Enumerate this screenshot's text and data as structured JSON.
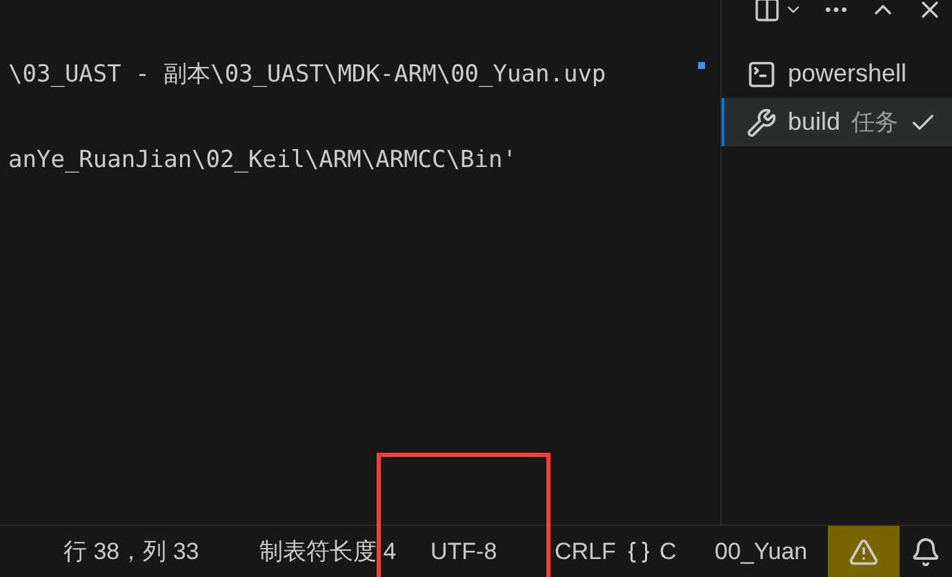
{
  "terminal": {
    "lines": [
      "\\03_UAST - 副本\\03_UAST\\MDK-ARM\\00_Yuan.uvp",
      "anYe_RuanJian\\02_Keil\\ARM\\ARMCC\\Bin'"
    ]
  },
  "terminal_tabs": [
    {
      "kind": "shell",
      "label": "powershell",
      "selected": false
    },
    {
      "kind": "task",
      "label": "build",
      "suffix": "任务",
      "selected": true
    }
  ],
  "status_bar": {
    "items": [
      {
        "kind": "text",
        "label": "行 38，列 33"
      },
      {
        "kind": "text",
        "label": "制表符长度 4"
      },
      {
        "kind": "text",
        "label": "UTF-8"
      },
      {
        "kind": "text",
        "label": "CRLF"
      },
      {
        "kind": "lang",
        "label": "C"
      },
      {
        "kind": "text",
        "label": "00_Yuan"
      },
      {
        "kind": "warning"
      },
      {
        "kind": "bell"
      }
    ]
  }
}
